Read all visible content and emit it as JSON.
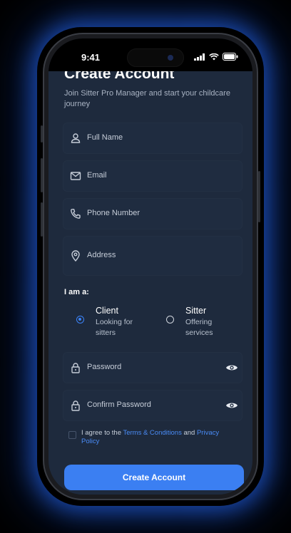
{
  "status_bar": {
    "time": "9:41"
  },
  "form": {
    "title": "Create Account",
    "subtitle": "Join Sitter Pro Manager and start your childcare journey",
    "full_name_placeholder": "Full Name",
    "email_placeholder": "Email",
    "phone_placeholder": "Phone Number",
    "address_placeholder": "Address",
    "role_label": "I am a:",
    "roles": [
      {
        "title": "Client",
        "description": "Looking for sitters",
        "selected": true
      },
      {
        "title": "Sitter",
        "description": "Offering services",
        "selected": false
      }
    ],
    "password_placeholder": "Password",
    "confirm_password_placeholder": "Confirm Password",
    "terms": {
      "prefix": "I agree to the",
      "terms_link": "Terms & Conditions",
      "conjunction": "and",
      "privacy_link": "Privacy Policy",
      "checked": false
    },
    "submit_label": "Create Account"
  },
  "colors": {
    "background": "#000000",
    "screen_bg": "#1e2a3d",
    "field_bg": "#1f2c40",
    "accent": "#3b7ff2",
    "link": "#4a8cf7",
    "glow": "#2a6eff"
  }
}
